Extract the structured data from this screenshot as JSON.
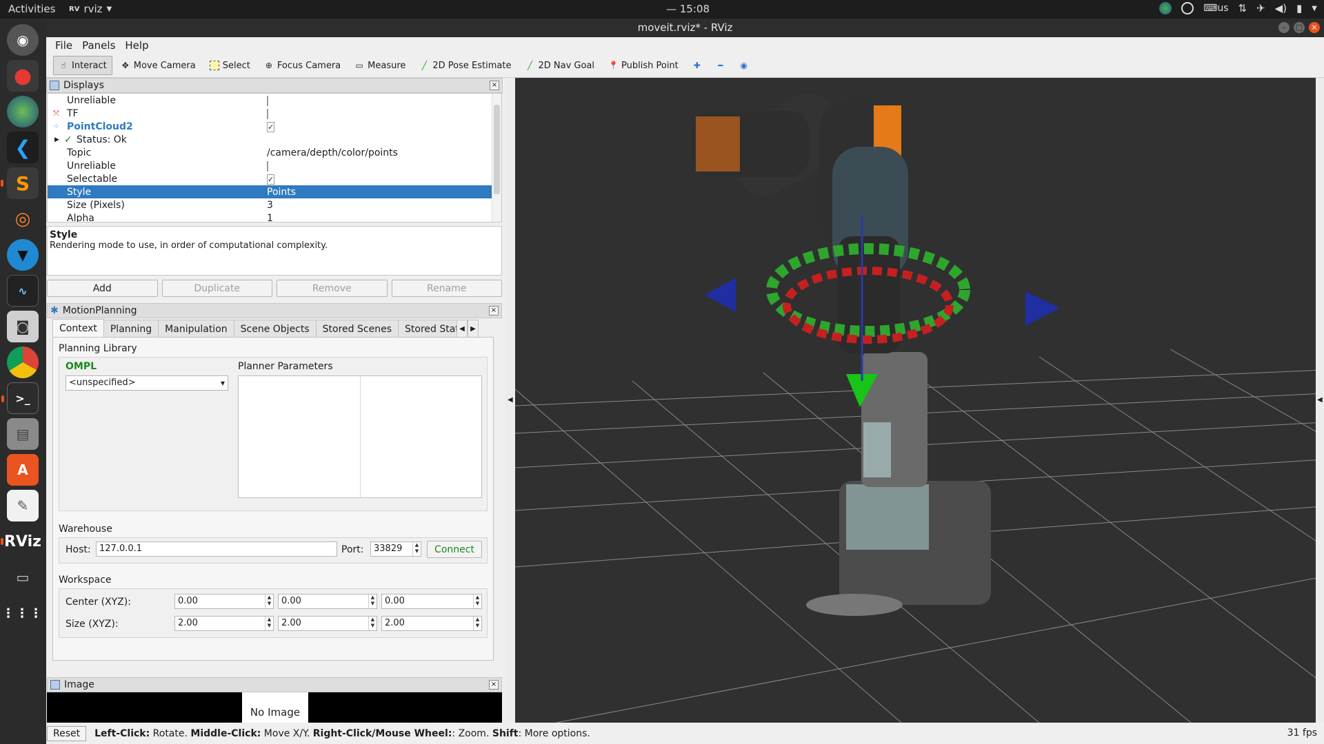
{
  "topbar": {
    "activities": "Activities",
    "app_name": "rviz",
    "clock": "— 15:08",
    "kbd": "us"
  },
  "window": {
    "title": "moveit.rviz* - RViz"
  },
  "menu": [
    "File",
    "Panels",
    "Help"
  ],
  "toolbar": {
    "tools": [
      {
        "label": "Interact",
        "icon": "interact-icon",
        "active": true
      },
      {
        "label": "Move Camera",
        "icon": "move-camera-icon",
        "active": false
      },
      {
        "label": "Select",
        "icon": "select-icon",
        "active": false
      },
      {
        "label": "Focus Camera",
        "icon": "focus-camera-icon",
        "active": false
      },
      {
        "label": "Measure",
        "icon": "measure-icon",
        "active": false
      },
      {
        "label": "2D Pose Estimate",
        "icon": "pose-estimate-icon",
        "active": false
      },
      {
        "label": "2D Nav Goal",
        "icon": "nav-goal-icon",
        "active": false
      },
      {
        "label": "Publish Point",
        "icon": "publish-point-icon",
        "active": false
      }
    ]
  },
  "displays": {
    "title": "Displays",
    "rows": [
      {
        "key": "Unreliable",
        "value": "",
        "check": "off"
      },
      {
        "key": "TF",
        "value": "",
        "check": "off",
        "icon": "tf-icon"
      },
      {
        "key": "PointCloud2",
        "value": "",
        "check": "on",
        "icon": "pointcloud-icon",
        "highlight": true
      },
      {
        "key": "Status: Ok",
        "value": "",
        "expander": true,
        "status": "ok"
      },
      {
        "key": "Topic",
        "value": "/camera/depth/color/points"
      },
      {
        "key": "Unreliable",
        "value": "",
        "check": "off"
      },
      {
        "key": "Selectable",
        "value": "",
        "check": "on"
      },
      {
        "key": "Style",
        "value": "Points",
        "selected": true
      },
      {
        "key": "Size (Pixels)",
        "value": "3"
      },
      {
        "key": "Alpha",
        "value": "1"
      }
    ],
    "desc_title": "Style",
    "desc_text": "Rendering mode to use, in order of computational complexity.",
    "buttons": {
      "add": "Add",
      "duplicate": "Duplicate",
      "remove": "Remove",
      "rename": "Rename"
    }
  },
  "motion": {
    "title": "MotionPlanning",
    "tabs": [
      "Context",
      "Planning",
      "Manipulation",
      "Scene Objects",
      "Stored Scenes",
      "Stored States"
    ],
    "planning_library": "Planning Library",
    "ompl": "OMPL",
    "planner": "<unspecified>",
    "planner_params": "Planner Parameters",
    "warehouse": "Warehouse",
    "host_label": "Host:",
    "host": "127.0.0.1",
    "port_label": "Port:",
    "port": "33829",
    "connect": "Connect",
    "workspace": "Workspace",
    "center_label": "Center (XYZ):",
    "size_label": "Size (XYZ):",
    "center": [
      "0.00",
      "0.00",
      "0.00"
    ],
    "size": [
      "2.00",
      "2.00",
      "2.00"
    ]
  },
  "image": {
    "title": "Image",
    "no_image": "No Image"
  },
  "status": {
    "reset": "Reset",
    "lc": "Left-Click:",
    "lc_t": " Rotate. ",
    "mc": "Middle-Click:",
    "mc_t": " Move X/Y. ",
    "rc": "Right-Click/Mouse Wheel:",
    "rc_t": ": Zoom. ",
    "sh": "Shift",
    "sh_t": ": More options.",
    "fps": "31 fps"
  }
}
